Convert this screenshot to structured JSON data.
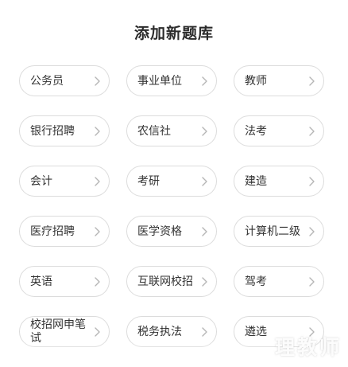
{
  "header": {
    "title": "添加新题库"
  },
  "categories": [
    {
      "label": "公务员"
    },
    {
      "label": "事业单位"
    },
    {
      "label": "教师"
    },
    {
      "label": "银行招聘"
    },
    {
      "label": "农信社"
    },
    {
      "label": "法考"
    },
    {
      "label": "会计"
    },
    {
      "label": "考研"
    },
    {
      "label": "建造"
    },
    {
      "label": "医疗招聘"
    },
    {
      "label": "医学资格"
    },
    {
      "label": "计算机二级"
    },
    {
      "label": "英语"
    },
    {
      "label": "互联网校招"
    },
    {
      "label": "驾考"
    },
    {
      "label": "校招网申笔试"
    },
    {
      "label": "税务执法"
    },
    {
      "label": "遴选"
    }
  ],
  "chevron_icon": "chevron-right-icon",
  "watermark": {
    "text": "理教师"
  },
  "colors": {
    "border": "#dcdcdc",
    "text": "#333333",
    "title": "#2b2b2b",
    "chevron": "#b5b5b5"
  }
}
